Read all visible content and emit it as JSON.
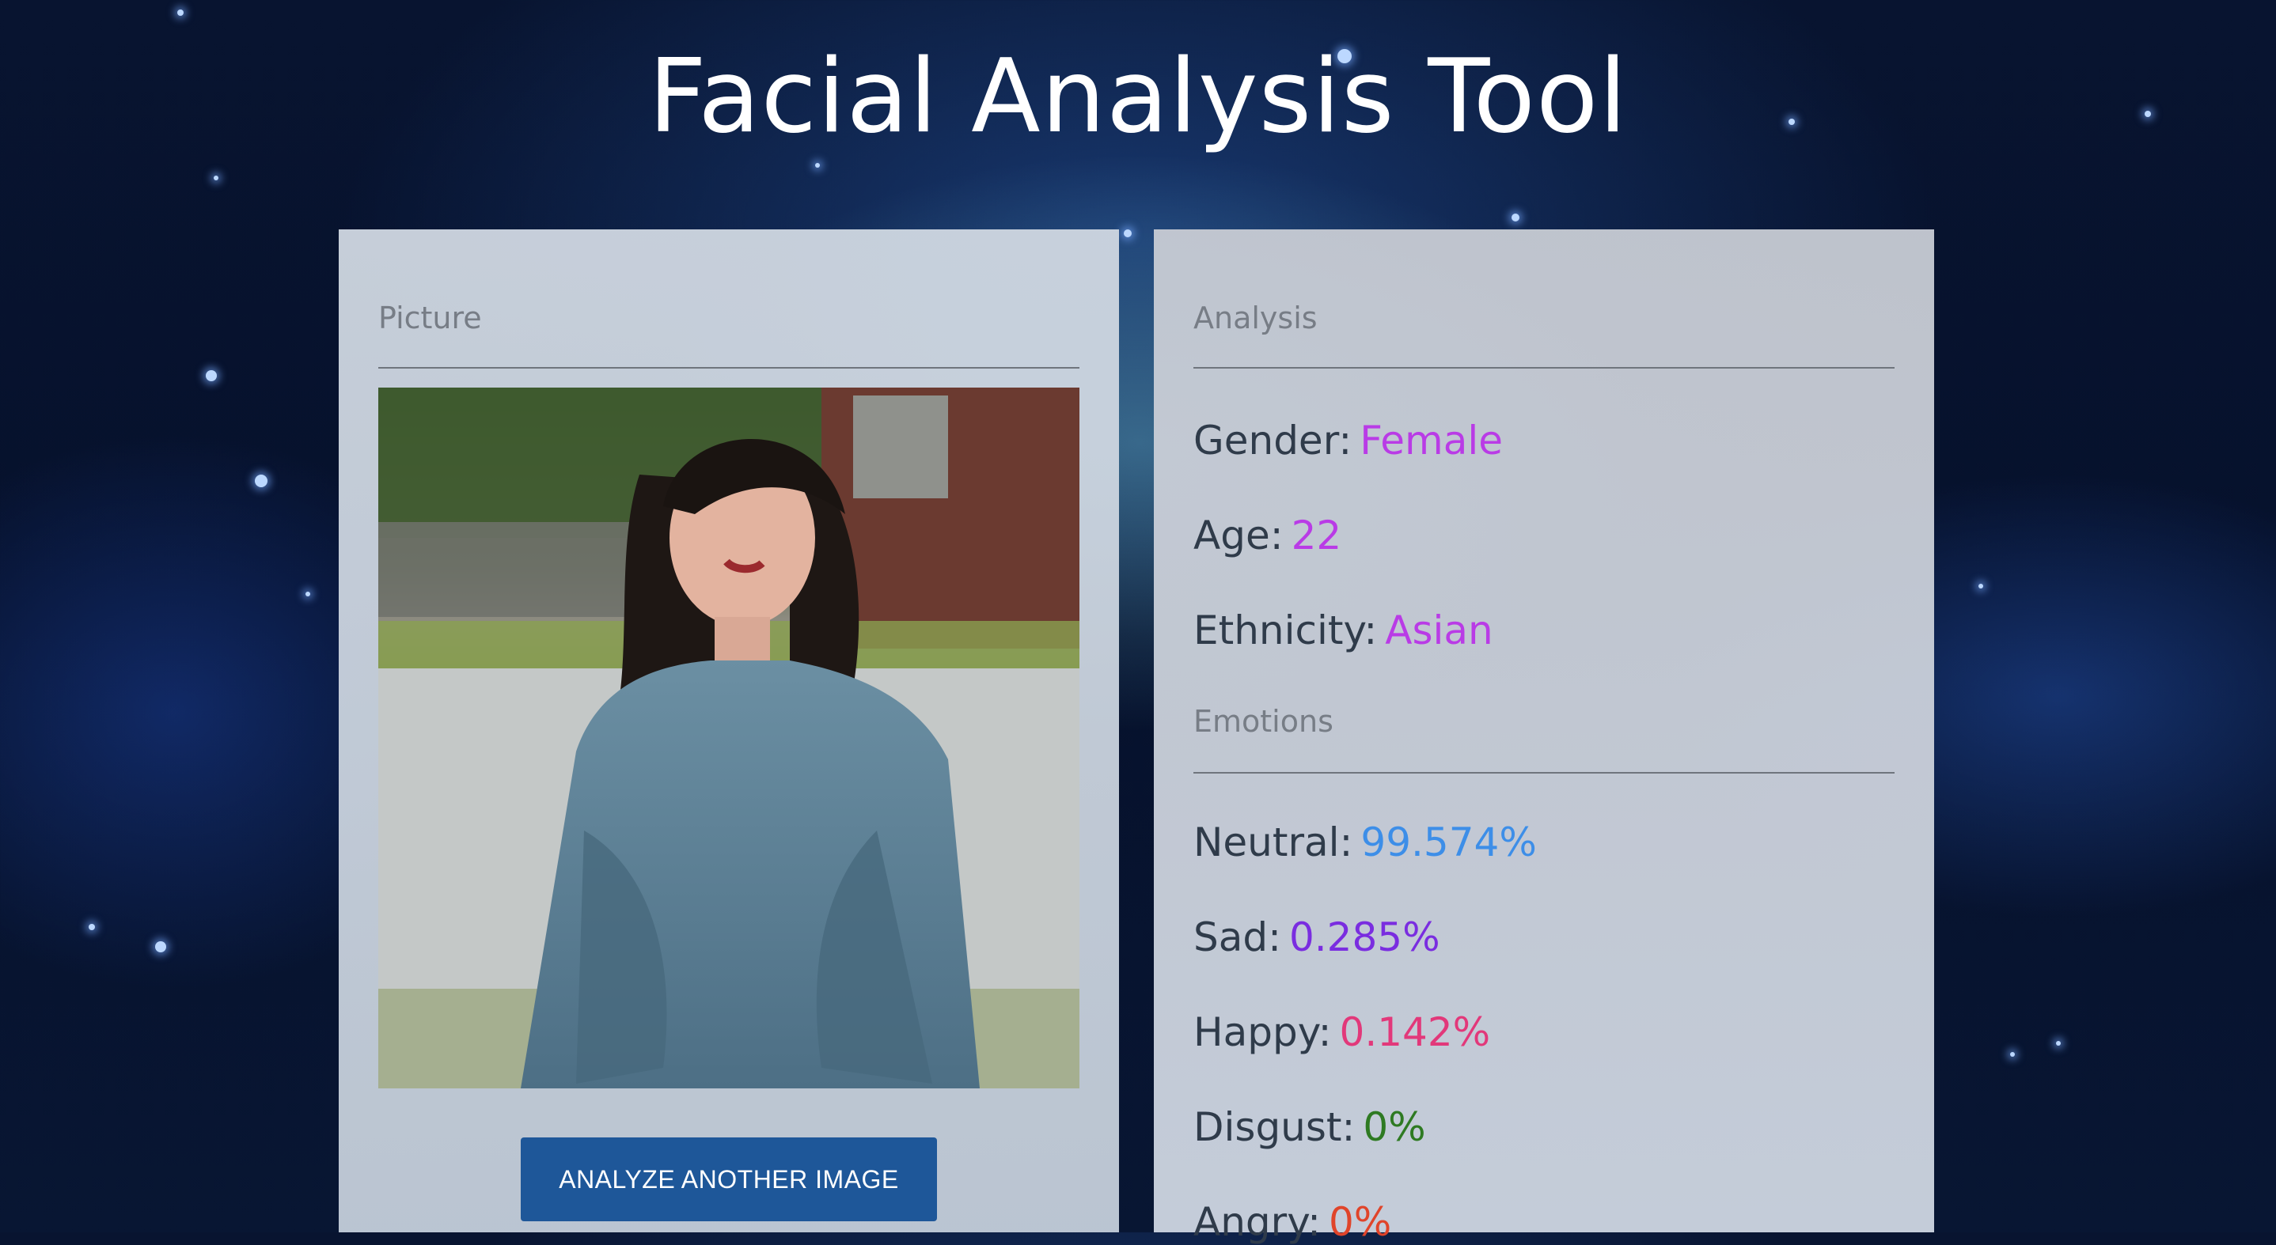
{
  "title": "Facial Analysis Tool",
  "picture_panel": {
    "heading": "Picture",
    "button_label": "ANALYZE ANOTHER IMAGE"
  },
  "analysis_panel": {
    "heading": "Analysis",
    "attributes": [
      {
        "label": "Gender:",
        "value": "Female",
        "color": "#b93be6"
      },
      {
        "label": "Age:",
        "value": "22",
        "color": "#b93be6"
      },
      {
        "label": "Ethnicity:",
        "value": "Asian",
        "color": "#b93be6"
      }
    ],
    "emotions_heading": "Emotions",
    "emotions": [
      {
        "label": "Neutral:",
        "value": "99.574%",
        "color": "#3d8ee8"
      },
      {
        "label": "Sad:",
        "value": "0.285%",
        "color": "#7a2de0"
      },
      {
        "label": "Happy:",
        "value": "0.142%",
        "color": "#e2387a"
      },
      {
        "label": "Disgust:",
        "value": "0%",
        "color": "#2e7a22"
      },
      {
        "label": "Angry:",
        "value": "0%",
        "color": "#e0442a"
      }
    ]
  }
}
